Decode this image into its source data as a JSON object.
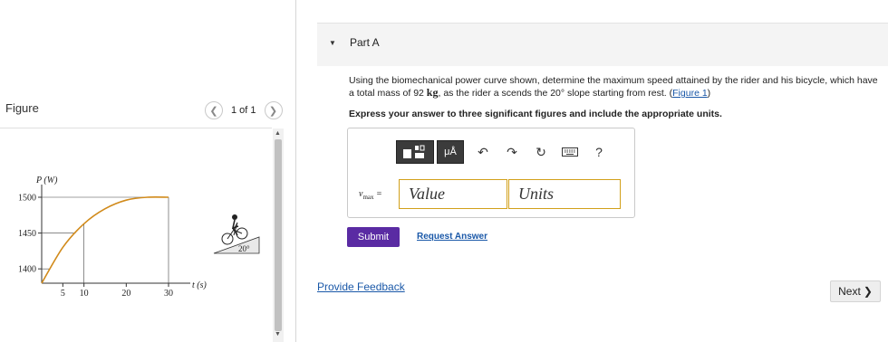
{
  "figure_panel": {
    "title": "Figure",
    "pager_text": "1 of 1",
    "prev_icon": "chevron-left-icon",
    "next_icon": "chevron-right-icon"
  },
  "chart_data": {
    "type": "line",
    "ylabel": "P (W)",
    "xlabel": "t (s)",
    "y_ticks": [
      "1500",
      "1450",
      "1400"
    ],
    "x_ticks": [
      "5",
      "10",
      "20",
      "30"
    ],
    "x": [
      0,
      5,
      10,
      15,
      20,
      25,
      30
    ],
    "values": [
      1380,
      1430,
      1463,
      1484,
      1496,
      1500,
      1500
    ],
    "ylim": [
      1380,
      1500
    ],
    "xlim": [
      0,
      30
    ],
    "line_color": "#d18a1a",
    "slope_angle_label": "20°"
  },
  "part": {
    "caret_icon": "caret-down-icon",
    "title": "Part A"
  },
  "question": {
    "text_before_mass": "Using the biomechanical power curve shown, determine the maximum speed attained by the rider and his bicycle, which have a total mass of 92 ",
    "mass_unit": "kg",
    "text_after_mass": ", as the rider a scends the 20° slope starting from rest. (",
    "figure_link": "Figure 1",
    "text_end": ")",
    "instruction": "Express your answer to three significant figures and include the appropriate units."
  },
  "toolbar": {
    "templates_icon": "templates-icon",
    "units_label": "μÅ",
    "undo_icon": "undo-icon",
    "redo_icon": "redo-icon",
    "reset_icon": "reset-icon",
    "keyboard_icon": "keyboard-icon",
    "help_label": "?"
  },
  "answer": {
    "variable": "v",
    "variable_sub": "max",
    "equals": "=",
    "value_placeholder": "Value",
    "units_placeholder": "Units"
  },
  "actions": {
    "submit": "Submit",
    "request_answer": "Request Answer",
    "provide_feedback": "Provide Feedback",
    "next": "Next",
    "next_icon": "chevron-right-icon"
  },
  "colors": {
    "submit_bg": "#5a2ba3",
    "link": "#1a58a8",
    "input_border": "#d2a01a"
  }
}
